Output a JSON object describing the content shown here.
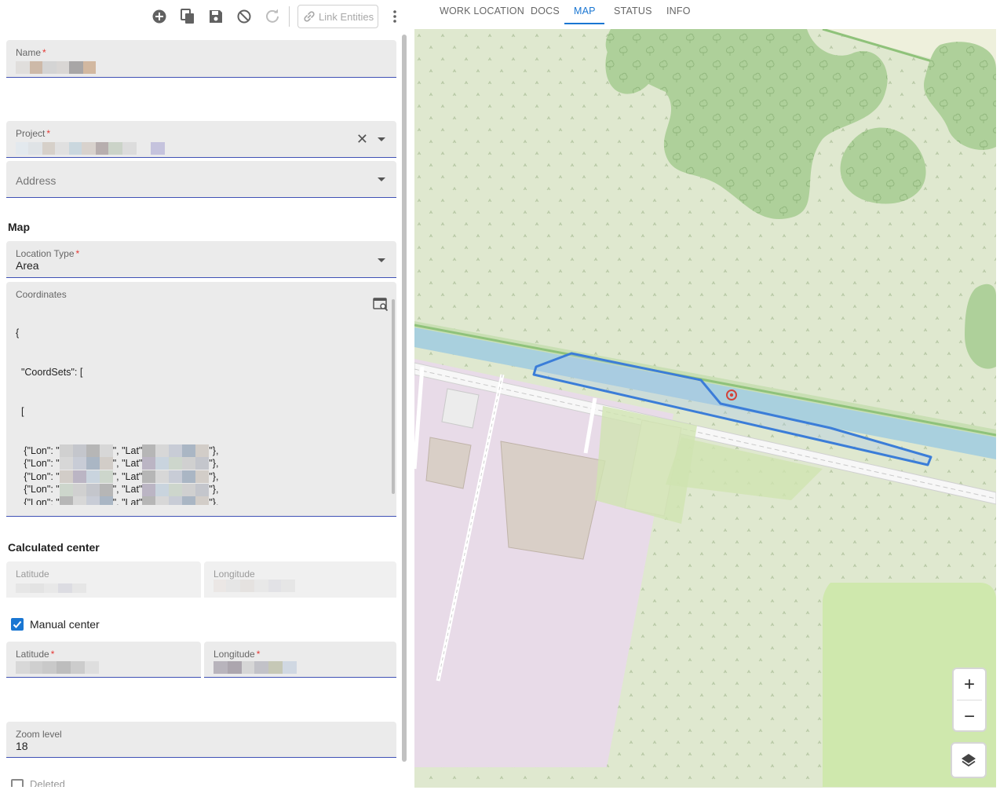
{
  "toolbar": {
    "icons": [
      "add-circle-icon",
      "copy-icon",
      "save-icon",
      "block-icon",
      "refresh-icon",
      "more-vert-icon"
    ],
    "link_label": "Link Entities"
  },
  "tabs": [
    {
      "label": "WORK LOCATION"
    },
    {
      "label": "DOCS"
    },
    {
      "label": "MAP",
      "active": true
    },
    {
      "label": "STATUS"
    },
    {
      "label": "INFO"
    }
  ],
  "form": {
    "name": {
      "label": "Name",
      "required_mark": "*"
    },
    "project": {
      "label": "Project",
      "required_mark": "*",
      "clear_symbol": "✕"
    },
    "address": {
      "placeholder": "Address"
    },
    "map_section": "Map",
    "location_type": {
      "label": "Location Type",
      "required_mark": "*",
      "value": "Area"
    },
    "coordinates": {
      "label": "Coordinates",
      "lines": [
        "{",
        "  \"CoordSets\": [",
        "  [",
        "   ]",
        "  ]",
        "  }"
      ],
      "coord_lon": "{\"Lon\": \"",
      "coord_lat": "\", \"Lat\"",
      "row_end": "\"},"
    },
    "calculated_center": {
      "title": "Calculated center",
      "latitude_label": "Latitude",
      "longitude_label": "Longitude"
    },
    "manual_center": {
      "label": "Manual center",
      "checked": true
    },
    "manual_latitude": {
      "label": "Latitude",
      "required_mark": "*"
    },
    "manual_longitude": {
      "label": "Longitude",
      "required_mark": "*"
    },
    "zoom_level": {
      "label": "Zoom level",
      "value": "18"
    },
    "deleted": {
      "label": "Deleted",
      "checked": false
    }
  },
  "map": {
    "zoom_in": "+",
    "zoom_out": "−",
    "canal_label": "...",
    "colors": {
      "grass": "#dfe8cf",
      "forest": "#aed09a",
      "water": "#a9d0de",
      "industrial": "#e8dbe8",
      "building": "#d9cfc7",
      "polygon_stroke": "#3b7dd8",
      "marker": "#d2443a"
    }
  }
}
